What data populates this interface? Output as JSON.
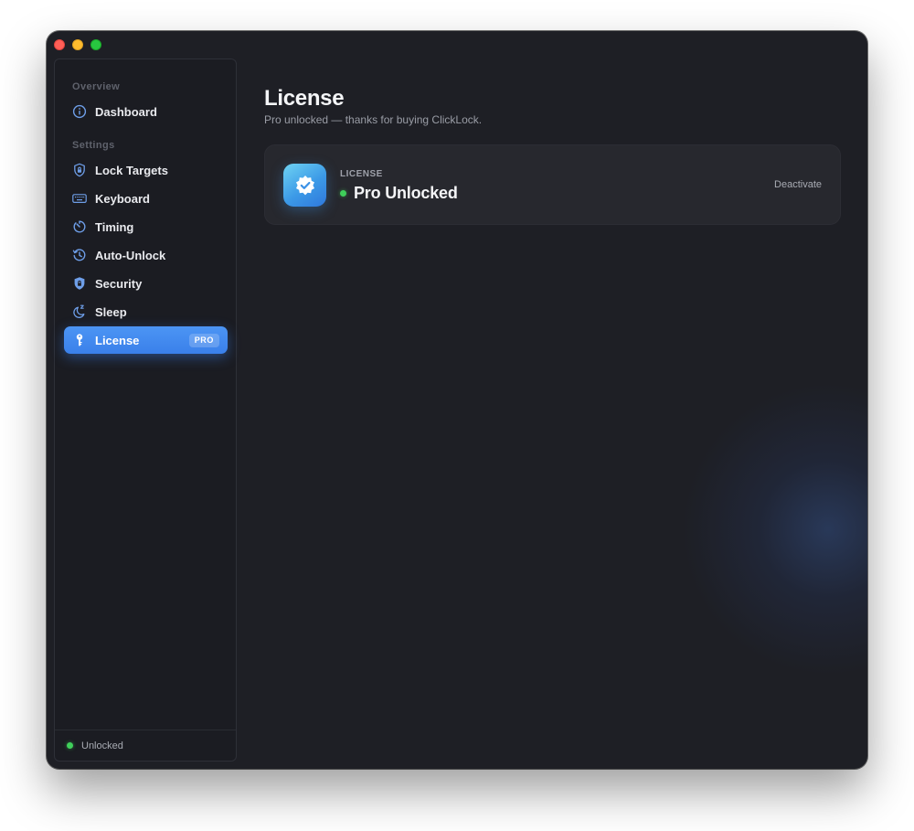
{
  "window": {
    "controls": [
      "close",
      "minimize",
      "zoom"
    ]
  },
  "sidebar": {
    "overview_label": "Overview",
    "settings_label": "Settings",
    "items": [
      {
        "label": "Dashboard",
        "icon": "info-circle-icon"
      },
      {
        "label": "Lock Targets",
        "icon": "shield-lock-icon"
      },
      {
        "label": "Keyboard",
        "icon": "keyboard-icon"
      },
      {
        "label": "Timing",
        "icon": "timer-icon"
      },
      {
        "label": "Auto-Unlock",
        "icon": "clock-history-icon"
      },
      {
        "label": "Security",
        "icon": "shield-icon"
      },
      {
        "label": "Sleep",
        "icon": "moon-zzz-icon"
      },
      {
        "label": "License",
        "icon": "key-icon",
        "badge": "PRO",
        "active": true
      }
    ],
    "footer": {
      "status_text": "Unlocked"
    }
  },
  "main": {
    "title": "License",
    "subtitle": "Pro unlocked — thanks for buying ClickLock.",
    "license_card": {
      "caption": "LICENSE",
      "status": "Pro Unlocked",
      "action_label": "Deactivate",
      "icon": "verified-badge-icon"
    }
  },
  "colors": {
    "accent": "#3a80ea",
    "window_bg": "#1e1f25",
    "sidebar_bg": "#1b1c22",
    "card_bg": "#27282e",
    "status_green": "#3fcf5a",
    "icon_blue": "#6e9ee8"
  }
}
